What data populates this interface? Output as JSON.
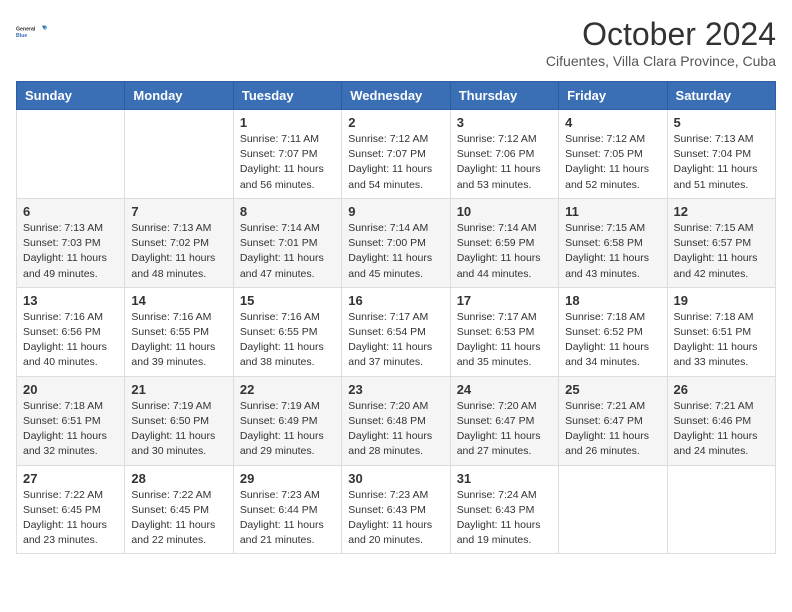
{
  "header": {
    "logo": {
      "general": "General",
      "blue": "Blue"
    },
    "title": "October 2024",
    "subtitle": "Cifuentes, Villa Clara Province, Cuba"
  },
  "weekdays": [
    "Sunday",
    "Monday",
    "Tuesday",
    "Wednesday",
    "Thursday",
    "Friday",
    "Saturday"
  ],
  "weeks": [
    [
      null,
      null,
      {
        "day": 1,
        "sunrise": "7:11 AM",
        "sunset": "7:07 PM",
        "daylight": "11 hours and 56 minutes."
      },
      {
        "day": 2,
        "sunrise": "7:12 AM",
        "sunset": "7:07 PM",
        "daylight": "11 hours and 54 minutes."
      },
      {
        "day": 3,
        "sunrise": "7:12 AM",
        "sunset": "7:06 PM",
        "daylight": "11 hours and 53 minutes."
      },
      {
        "day": 4,
        "sunrise": "7:12 AM",
        "sunset": "7:05 PM",
        "daylight": "11 hours and 52 minutes."
      },
      {
        "day": 5,
        "sunrise": "7:13 AM",
        "sunset": "7:04 PM",
        "daylight": "11 hours and 51 minutes."
      }
    ],
    [
      {
        "day": 6,
        "sunrise": "7:13 AM",
        "sunset": "7:03 PM",
        "daylight": "11 hours and 49 minutes."
      },
      {
        "day": 7,
        "sunrise": "7:13 AM",
        "sunset": "7:02 PM",
        "daylight": "11 hours and 48 minutes."
      },
      {
        "day": 8,
        "sunrise": "7:14 AM",
        "sunset": "7:01 PM",
        "daylight": "11 hours and 47 minutes."
      },
      {
        "day": 9,
        "sunrise": "7:14 AM",
        "sunset": "7:00 PM",
        "daylight": "11 hours and 45 minutes."
      },
      {
        "day": 10,
        "sunrise": "7:14 AM",
        "sunset": "6:59 PM",
        "daylight": "11 hours and 44 minutes."
      },
      {
        "day": 11,
        "sunrise": "7:15 AM",
        "sunset": "6:58 PM",
        "daylight": "11 hours and 43 minutes."
      },
      {
        "day": 12,
        "sunrise": "7:15 AM",
        "sunset": "6:57 PM",
        "daylight": "11 hours and 42 minutes."
      }
    ],
    [
      {
        "day": 13,
        "sunrise": "7:16 AM",
        "sunset": "6:56 PM",
        "daylight": "11 hours and 40 minutes."
      },
      {
        "day": 14,
        "sunrise": "7:16 AM",
        "sunset": "6:55 PM",
        "daylight": "11 hours and 39 minutes."
      },
      {
        "day": 15,
        "sunrise": "7:16 AM",
        "sunset": "6:55 PM",
        "daylight": "11 hours and 38 minutes."
      },
      {
        "day": 16,
        "sunrise": "7:17 AM",
        "sunset": "6:54 PM",
        "daylight": "11 hours and 37 minutes."
      },
      {
        "day": 17,
        "sunrise": "7:17 AM",
        "sunset": "6:53 PM",
        "daylight": "11 hours and 35 minutes."
      },
      {
        "day": 18,
        "sunrise": "7:18 AM",
        "sunset": "6:52 PM",
        "daylight": "11 hours and 34 minutes."
      },
      {
        "day": 19,
        "sunrise": "7:18 AM",
        "sunset": "6:51 PM",
        "daylight": "11 hours and 33 minutes."
      }
    ],
    [
      {
        "day": 20,
        "sunrise": "7:18 AM",
        "sunset": "6:51 PM",
        "daylight": "11 hours and 32 minutes."
      },
      {
        "day": 21,
        "sunrise": "7:19 AM",
        "sunset": "6:50 PM",
        "daylight": "11 hours and 30 minutes."
      },
      {
        "day": 22,
        "sunrise": "7:19 AM",
        "sunset": "6:49 PM",
        "daylight": "11 hours and 29 minutes."
      },
      {
        "day": 23,
        "sunrise": "7:20 AM",
        "sunset": "6:48 PM",
        "daylight": "11 hours and 28 minutes."
      },
      {
        "day": 24,
        "sunrise": "7:20 AM",
        "sunset": "6:47 PM",
        "daylight": "11 hours and 27 minutes."
      },
      {
        "day": 25,
        "sunrise": "7:21 AM",
        "sunset": "6:47 PM",
        "daylight": "11 hours and 26 minutes."
      },
      {
        "day": 26,
        "sunrise": "7:21 AM",
        "sunset": "6:46 PM",
        "daylight": "11 hours and 24 minutes."
      }
    ],
    [
      {
        "day": 27,
        "sunrise": "7:22 AM",
        "sunset": "6:45 PM",
        "daylight": "11 hours and 23 minutes."
      },
      {
        "day": 28,
        "sunrise": "7:22 AM",
        "sunset": "6:45 PM",
        "daylight": "11 hours and 22 minutes."
      },
      {
        "day": 29,
        "sunrise": "7:23 AM",
        "sunset": "6:44 PM",
        "daylight": "11 hours and 21 minutes."
      },
      {
        "day": 30,
        "sunrise": "7:23 AM",
        "sunset": "6:43 PM",
        "daylight": "11 hours and 20 minutes."
      },
      {
        "day": 31,
        "sunrise": "7:24 AM",
        "sunset": "6:43 PM",
        "daylight": "11 hours and 19 minutes."
      },
      null,
      null
    ]
  ],
  "labels": {
    "sunrise": "Sunrise:",
    "sunset": "Sunset:",
    "daylight": "Daylight:"
  }
}
